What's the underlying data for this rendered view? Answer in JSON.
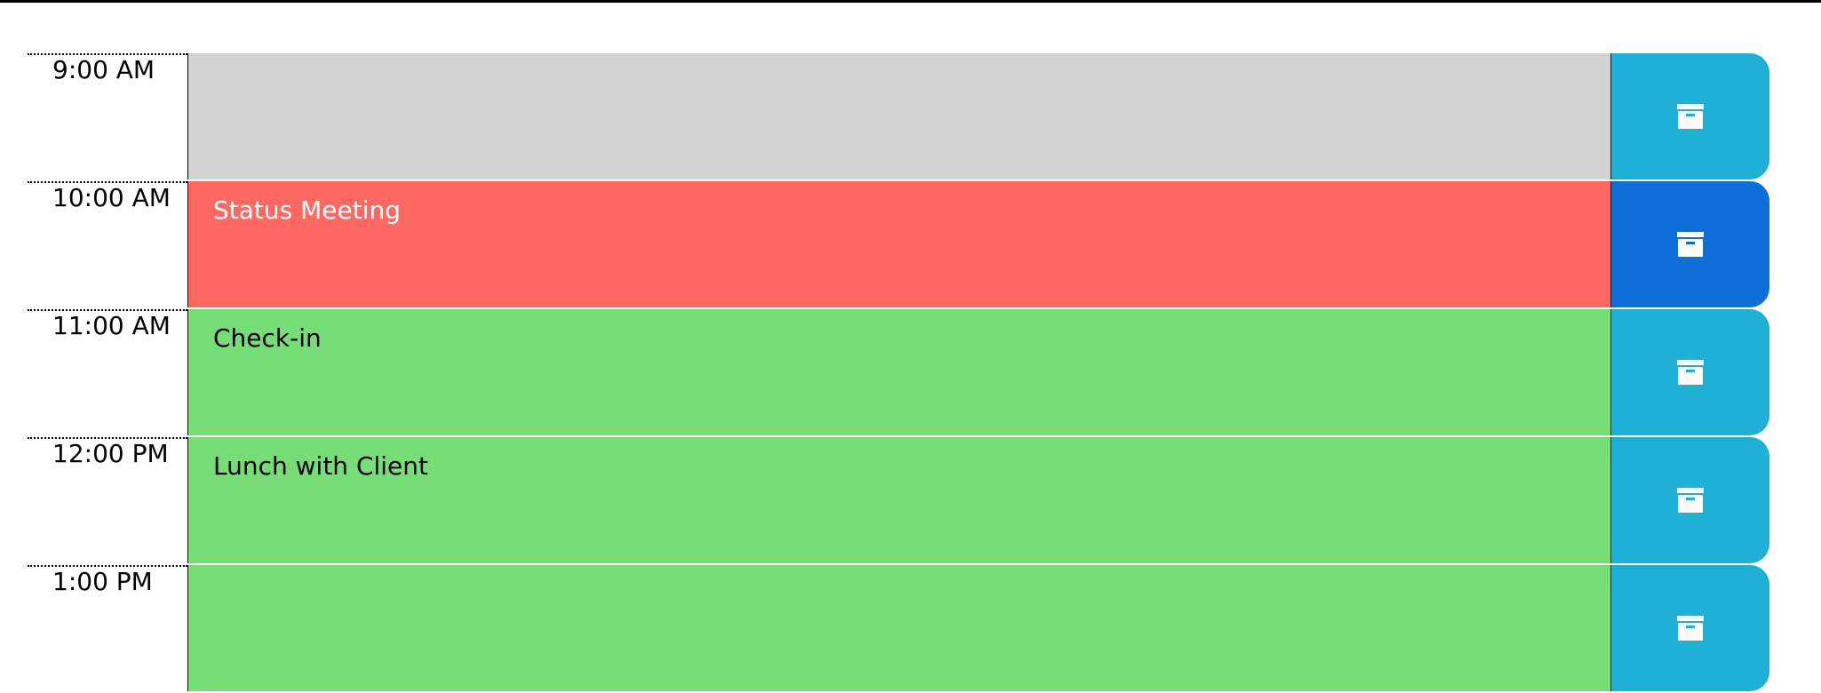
{
  "colors": {
    "past": "#d3d3d3",
    "present": "#ff6961",
    "future": "#77dd77",
    "save_button": "#1fb0d5",
    "save_button_active": "#0f6fd8"
  },
  "save_icon": "archive-icon",
  "timeblocks": [
    {
      "hour": "9:00 AM",
      "text": "",
      "state": "past",
      "save_active": false
    },
    {
      "hour": "10:00 AM",
      "text": "Status Meeting",
      "state": "present",
      "save_active": true
    },
    {
      "hour": "11:00 AM",
      "text": "Check-in",
      "state": "future",
      "save_active": false
    },
    {
      "hour": "12:00 PM",
      "text": "Lunch with Client",
      "state": "future",
      "save_active": false
    },
    {
      "hour": "1:00 PM",
      "text": "",
      "state": "future",
      "save_active": false
    }
  ]
}
